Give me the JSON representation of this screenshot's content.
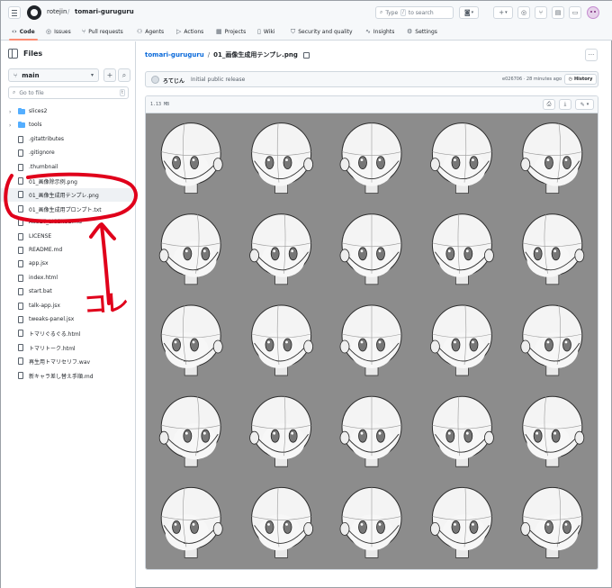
{
  "header": {
    "owner": "rotejin",
    "separator": "/",
    "repo": "tomari-guruguru",
    "search_placeholder": "Type",
    "search_shortcut": "/",
    "search_suffix": "to search",
    "new_button": "+",
    "new_caret": "▾"
  },
  "repo_nav": [
    {
      "label": "Code",
      "icon": "code-icon",
      "active": true
    },
    {
      "label": "Issues",
      "icon": "issue-icon"
    },
    {
      "label": "Pull requests",
      "icon": "pull-request-icon"
    },
    {
      "label": "Agents",
      "icon": "agent-icon"
    },
    {
      "label": "Actions",
      "icon": "play-icon"
    },
    {
      "label": "Projects",
      "icon": "table-icon"
    },
    {
      "label": "Wiki",
      "icon": "book-icon"
    },
    {
      "label": "Security and quality",
      "icon": "shield-icon"
    },
    {
      "label": "Insights",
      "icon": "graph-icon"
    },
    {
      "label": "Settings",
      "icon": "gear-icon"
    }
  ],
  "sidebar": {
    "title": "Files",
    "branch": "main",
    "add_button": "+",
    "search_button": "⌕",
    "goto_placeholder": "Go to file",
    "goto_shortcut": "t",
    "tree": [
      {
        "type": "folder",
        "name": "slices2"
      },
      {
        "type": "folder",
        "name": "tools"
      },
      {
        "type": "file",
        "name": ".gitattributes"
      },
      {
        "type": "file",
        "name": ".gitignore"
      },
      {
        "type": "file",
        "name": ".thumbnail"
      },
      {
        "type": "file",
        "name": "01_画像除示例.png"
      },
      {
        "type": "file",
        "name": "01_画像生成用テンプレ.png",
        "selected": true
      },
      {
        "type": "file",
        "name": "01_画像生成用プロンプト.txt"
      },
      {
        "type": "file",
        "name": "ASSET_LICENSE.md"
      },
      {
        "type": "file",
        "name": "LICENSE"
      },
      {
        "type": "file",
        "name": "README.md"
      },
      {
        "type": "file",
        "name": "app.jsx"
      },
      {
        "type": "file",
        "name": "index.html"
      },
      {
        "type": "file",
        "name": "start.bat"
      },
      {
        "type": "file",
        "name": "talk-app.jsx"
      },
      {
        "type": "file",
        "name": "tweaks-panel.jsx"
      },
      {
        "type": "file",
        "name": "トマリぐるぐる.html"
      },
      {
        "type": "file",
        "name": "トマリトーク.html"
      },
      {
        "type": "file",
        "name": "再生用トマリセリフ.wav"
      },
      {
        "type": "file",
        "name": "新キャラ差し替え手順.md"
      }
    ]
  },
  "annotation": {
    "text": "コレ",
    "color": "#e0001b"
  },
  "main": {
    "repo_link": "tomari-guruguru",
    "separator": "/",
    "file_name": "01_画像生成用テンプレ.png",
    "more_button": "···",
    "commit": {
      "author": "ろてじん",
      "message": "Initial public release",
      "meta": "e026706 · 28 minutes ago",
      "history_label": "History"
    },
    "file_size": "1.13 MB"
  },
  "colors": {
    "link": "#0969da",
    "accent_underline": "#fd8c73",
    "image_background": "#8c8c8c",
    "folder": "#54aeff"
  }
}
